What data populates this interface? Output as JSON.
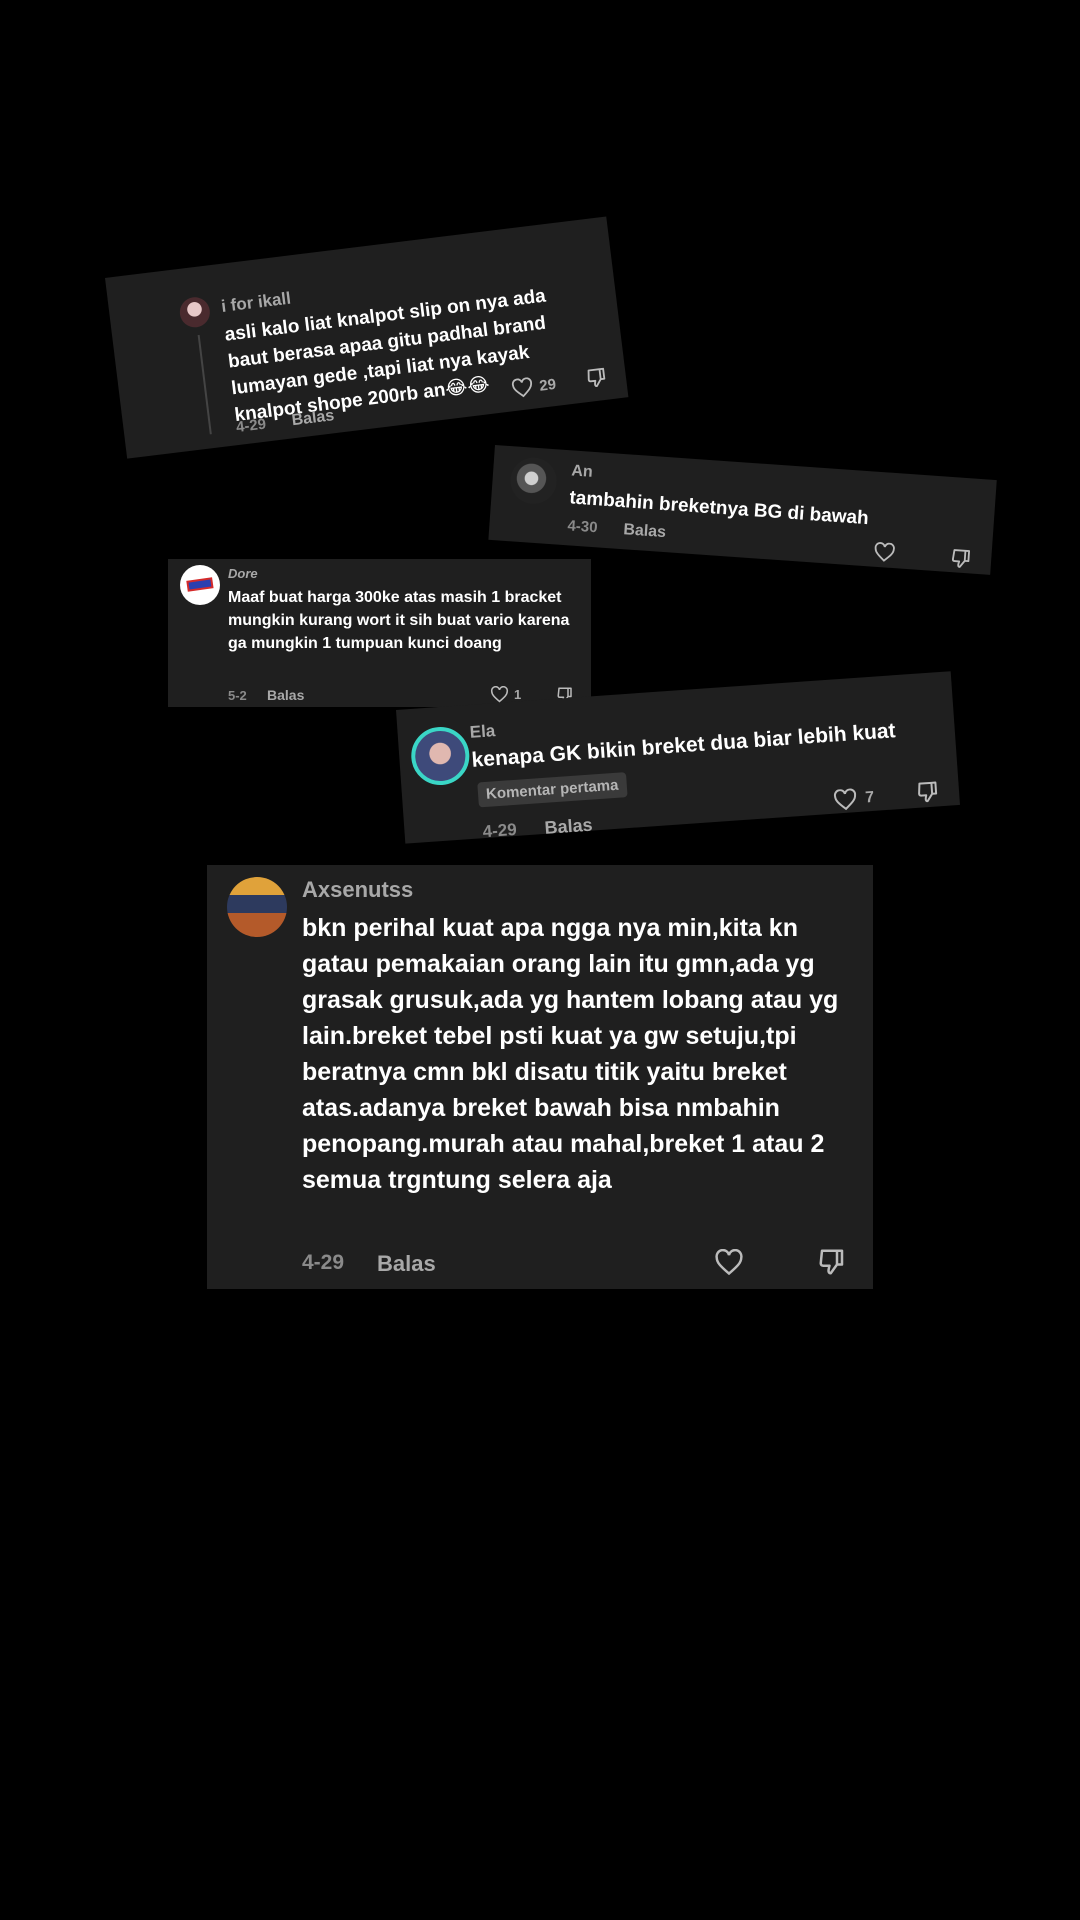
{
  "comments": [
    {
      "username": "i for ikall",
      "text": "asli kalo liat knalpot slip on nya ada baut berasa apaa gitu padhal brand lumayan gede  ,tapi liat nya kayak knalpot shope 200rb an😂😂",
      "date": "4-29",
      "reply_label": "Balas",
      "likes": "29"
    },
    {
      "username": "An",
      "text": "tambahin breketnya BG di bawah",
      "date": "4-30",
      "reply_label": "Balas",
      "likes": ""
    },
    {
      "username": "Dore",
      "text": "Maaf buat harga 300ke atas masih 1 bracket mungkin kurang wort it sih buat vario karena ga mungkin 1 tumpuan kunci doang",
      "date": "5-2",
      "reply_label": "Balas",
      "likes": "1"
    },
    {
      "username": "Ela",
      "text": "kenapa GK bikin breket dua biar lebih kuat",
      "badge": "Komentar pertama",
      "date": "4-29",
      "reply_label": "Balas",
      "likes": "7"
    },
    {
      "username": "Axsenutss",
      "text": "bkn perihal kuat apa ngga nya min,kita kn gatau pemakaian orang lain itu gmn,ada yg grasak grusuk,ada yg hantem lobang atau yg lain.breket tebel psti kuat ya gw setuju,tpi beratnya cmn bkl disatu titik yaitu breket atas.adanya breket bawah bisa nmbahin penopang.murah atau mahal,breket 1 atau 2 semua trgntung selera aja",
      "date": "4-29",
      "reply_label": "Balas",
      "likes": ""
    }
  ],
  "icons": {
    "like": "heart-outline-icon",
    "dislike": "thumbs-down-outline-icon"
  },
  "colors": {
    "background": "#000000",
    "card": "#1f1f1f",
    "muted_text": "#a8a8a8",
    "ela_avatar_ring": "#3ad6c6"
  }
}
